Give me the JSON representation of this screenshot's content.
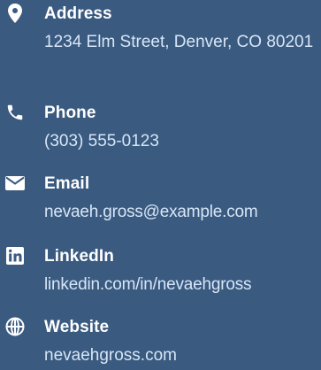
{
  "accent_color": "#ffffff",
  "background_color": "#3a5a80",
  "value_color": "#d7e6f7",
  "contact": {
    "address": {
      "icon": "map-marker-icon",
      "label": "Address",
      "value": "1234 Elm Street, Denver, CO 80201"
    },
    "phone": {
      "icon": "phone-icon",
      "label": "Phone",
      "value": "(303) 555-0123"
    },
    "email": {
      "icon": "envelope-icon",
      "label": "Email",
      "value": "nevaeh.gross@example.com"
    },
    "linkedin": {
      "icon": "linkedin-icon",
      "label": "LinkedIn",
      "value": "linkedin.com/in/nevaehgross"
    },
    "website": {
      "icon": "globe-icon",
      "label": "Website",
      "value": "nevaehgross.com"
    }
  }
}
